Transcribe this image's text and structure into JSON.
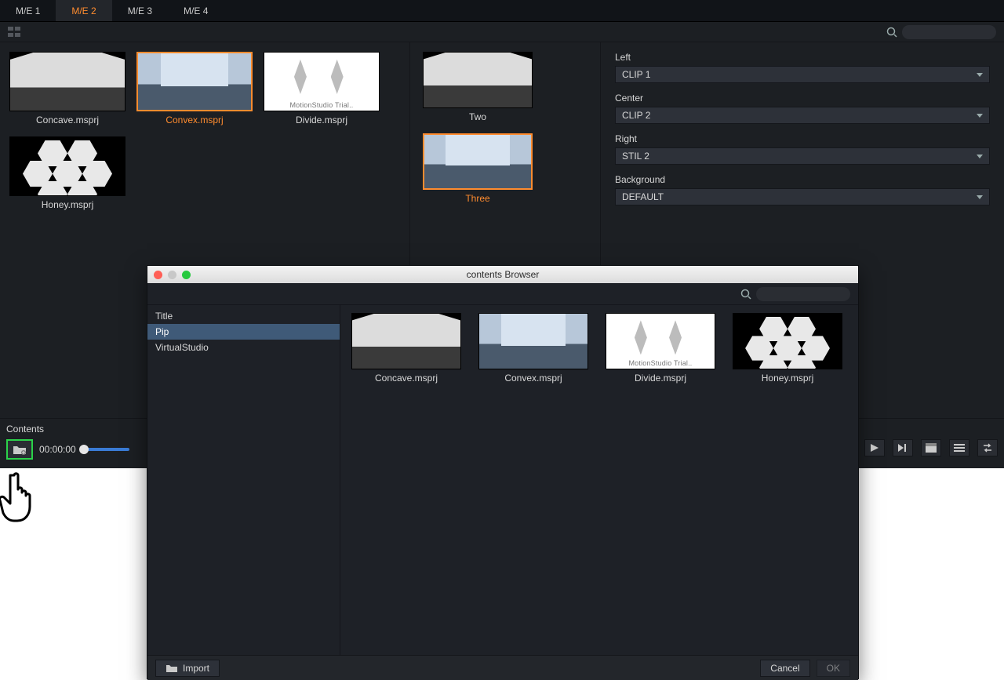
{
  "tabs": [
    "M/E 1",
    "M/E 2",
    "M/E 3",
    "M/E 4"
  ],
  "active_tab": 1,
  "thumbs_left": [
    {
      "name": "Concave.msprj",
      "kind": "concave"
    },
    {
      "name": "Convex.msprj",
      "kind": "convex",
      "sel": true
    },
    {
      "name": "Divide.msprj",
      "kind": "divide"
    },
    {
      "name": "Honey.msprj",
      "kind": "honey"
    }
  ],
  "thumbs_mid": [
    {
      "name": "Two",
      "kind": "concave"
    },
    {
      "name": "Three",
      "kind": "convex",
      "sel": true
    }
  ],
  "props": {
    "left": {
      "label": "Left",
      "value": "CLIP 1"
    },
    "center": {
      "label": "Center",
      "value": "CLIP 2"
    },
    "right": {
      "label": "Right",
      "value": "STIL 2"
    },
    "background": {
      "label": "Background",
      "value": "DEFAULT"
    }
  },
  "contents_label": "Contents",
  "timecode": "00:00:00",
  "dialog": {
    "title": "contents Browser",
    "categories": [
      "Title",
      "Pip",
      "VirtualStudio"
    ],
    "selected_category": 1,
    "items": [
      {
        "name": "Concave.msprj",
        "kind": "concave"
      },
      {
        "name": "Convex.msprj",
        "kind": "convex"
      },
      {
        "name": "Divide.msprj",
        "kind": "divide"
      },
      {
        "name": "Honey.msprj",
        "kind": "honey"
      }
    ],
    "import": "Import",
    "cancel": "Cancel",
    "ok": "OK"
  }
}
